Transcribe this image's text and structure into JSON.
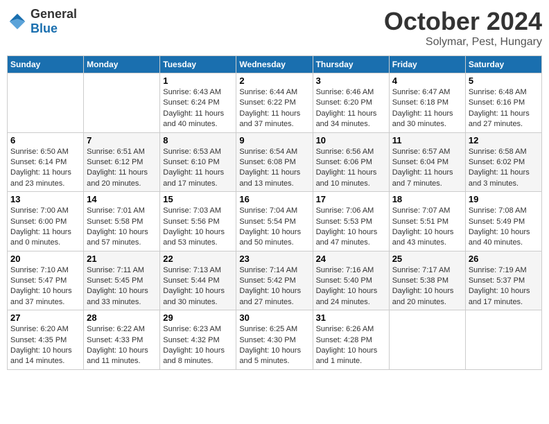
{
  "header": {
    "logo": {
      "general": "General",
      "blue": "Blue"
    },
    "month": "October 2024",
    "location": "Solymar, Pest, Hungary"
  },
  "weekdays": [
    "Sunday",
    "Monday",
    "Tuesday",
    "Wednesday",
    "Thursday",
    "Friday",
    "Saturday"
  ],
  "weeks": [
    [
      {
        "day": "",
        "info": ""
      },
      {
        "day": "",
        "info": ""
      },
      {
        "day": "1",
        "info": "Sunrise: 6:43 AM\nSunset: 6:24 PM\nDaylight: 11 hours and 40 minutes."
      },
      {
        "day": "2",
        "info": "Sunrise: 6:44 AM\nSunset: 6:22 PM\nDaylight: 11 hours and 37 minutes."
      },
      {
        "day": "3",
        "info": "Sunrise: 6:46 AM\nSunset: 6:20 PM\nDaylight: 11 hours and 34 minutes."
      },
      {
        "day": "4",
        "info": "Sunrise: 6:47 AM\nSunset: 6:18 PM\nDaylight: 11 hours and 30 minutes."
      },
      {
        "day": "5",
        "info": "Sunrise: 6:48 AM\nSunset: 6:16 PM\nDaylight: 11 hours and 27 minutes."
      }
    ],
    [
      {
        "day": "6",
        "info": "Sunrise: 6:50 AM\nSunset: 6:14 PM\nDaylight: 11 hours and 23 minutes."
      },
      {
        "day": "7",
        "info": "Sunrise: 6:51 AM\nSunset: 6:12 PM\nDaylight: 11 hours and 20 minutes."
      },
      {
        "day": "8",
        "info": "Sunrise: 6:53 AM\nSunset: 6:10 PM\nDaylight: 11 hours and 17 minutes."
      },
      {
        "day": "9",
        "info": "Sunrise: 6:54 AM\nSunset: 6:08 PM\nDaylight: 11 hours and 13 minutes."
      },
      {
        "day": "10",
        "info": "Sunrise: 6:56 AM\nSunset: 6:06 PM\nDaylight: 11 hours and 10 minutes."
      },
      {
        "day": "11",
        "info": "Sunrise: 6:57 AM\nSunset: 6:04 PM\nDaylight: 11 hours and 7 minutes."
      },
      {
        "day": "12",
        "info": "Sunrise: 6:58 AM\nSunset: 6:02 PM\nDaylight: 11 hours and 3 minutes."
      }
    ],
    [
      {
        "day": "13",
        "info": "Sunrise: 7:00 AM\nSunset: 6:00 PM\nDaylight: 11 hours and 0 minutes."
      },
      {
        "day": "14",
        "info": "Sunrise: 7:01 AM\nSunset: 5:58 PM\nDaylight: 10 hours and 57 minutes."
      },
      {
        "day": "15",
        "info": "Sunrise: 7:03 AM\nSunset: 5:56 PM\nDaylight: 10 hours and 53 minutes."
      },
      {
        "day": "16",
        "info": "Sunrise: 7:04 AM\nSunset: 5:54 PM\nDaylight: 10 hours and 50 minutes."
      },
      {
        "day": "17",
        "info": "Sunrise: 7:06 AM\nSunset: 5:53 PM\nDaylight: 10 hours and 47 minutes."
      },
      {
        "day": "18",
        "info": "Sunrise: 7:07 AM\nSunset: 5:51 PM\nDaylight: 10 hours and 43 minutes."
      },
      {
        "day": "19",
        "info": "Sunrise: 7:08 AM\nSunset: 5:49 PM\nDaylight: 10 hours and 40 minutes."
      }
    ],
    [
      {
        "day": "20",
        "info": "Sunrise: 7:10 AM\nSunset: 5:47 PM\nDaylight: 10 hours and 37 minutes."
      },
      {
        "day": "21",
        "info": "Sunrise: 7:11 AM\nSunset: 5:45 PM\nDaylight: 10 hours and 33 minutes."
      },
      {
        "day": "22",
        "info": "Sunrise: 7:13 AM\nSunset: 5:44 PM\nDaylight: 10 hours and 30 minutes."
      },
      {
        "day": "23",
        "info": "Sunrise: 7:14 AM\nSunset: 5:42 PM\nDaylight: 10 hours and 27 minutes."
      },
      {
        "day": "24",
        "info": "Sunrise: 7:16 AM\nSunset: 5:40 PM\nDaylight: 10 hours and 24 minutes."
      },
      {
        "day": "25",
        "info": "Sunrise: 7:17 AM\nSunset: 5:38 PM\nDaylight: 10 hours and 20 minutes."
      },
      {
        "day": "26",
        "info": "Sunrise: 7:19 AM\nSunset: 5:37 PM\nDaylight: 10 hours and 17 minutes."
      }
    ],
    [
      {
        "day": "27",
        "info": "Sunrise: 6:20 AM\nSunset: 4:35 PM\nDaylight: 10 hours and 14 minutes."
      },
      {
        "day": "28",
        "info": "Sunrise: 6:22 AM\nSunset: 4:33 PM\nDaylight: 10 hours and 11 minutes."
      },
      {
        "day": "29",
        "info": "Sunrise: 6:23 AM\nSunset: 4:32 PM\nDaylight: 10 hours and 8 minutes."
      },
      {
        "day": "30",
        "info": "Sunrise: 6:25 AM\nSunset: 4:30 PM\nDaylight: 10 hours and 5 minutes."
      },
      {
        "day": "31",
        "info": "Sunrise: 6:26 AM\nSunset: 4:28 PM\nDaylight: 10 hours and 1 minute."
      },
      {
        "day": "",
        "info": ""
      },
      {
        "day": "",
        "info": ""
      }
    ]
  ]
}
